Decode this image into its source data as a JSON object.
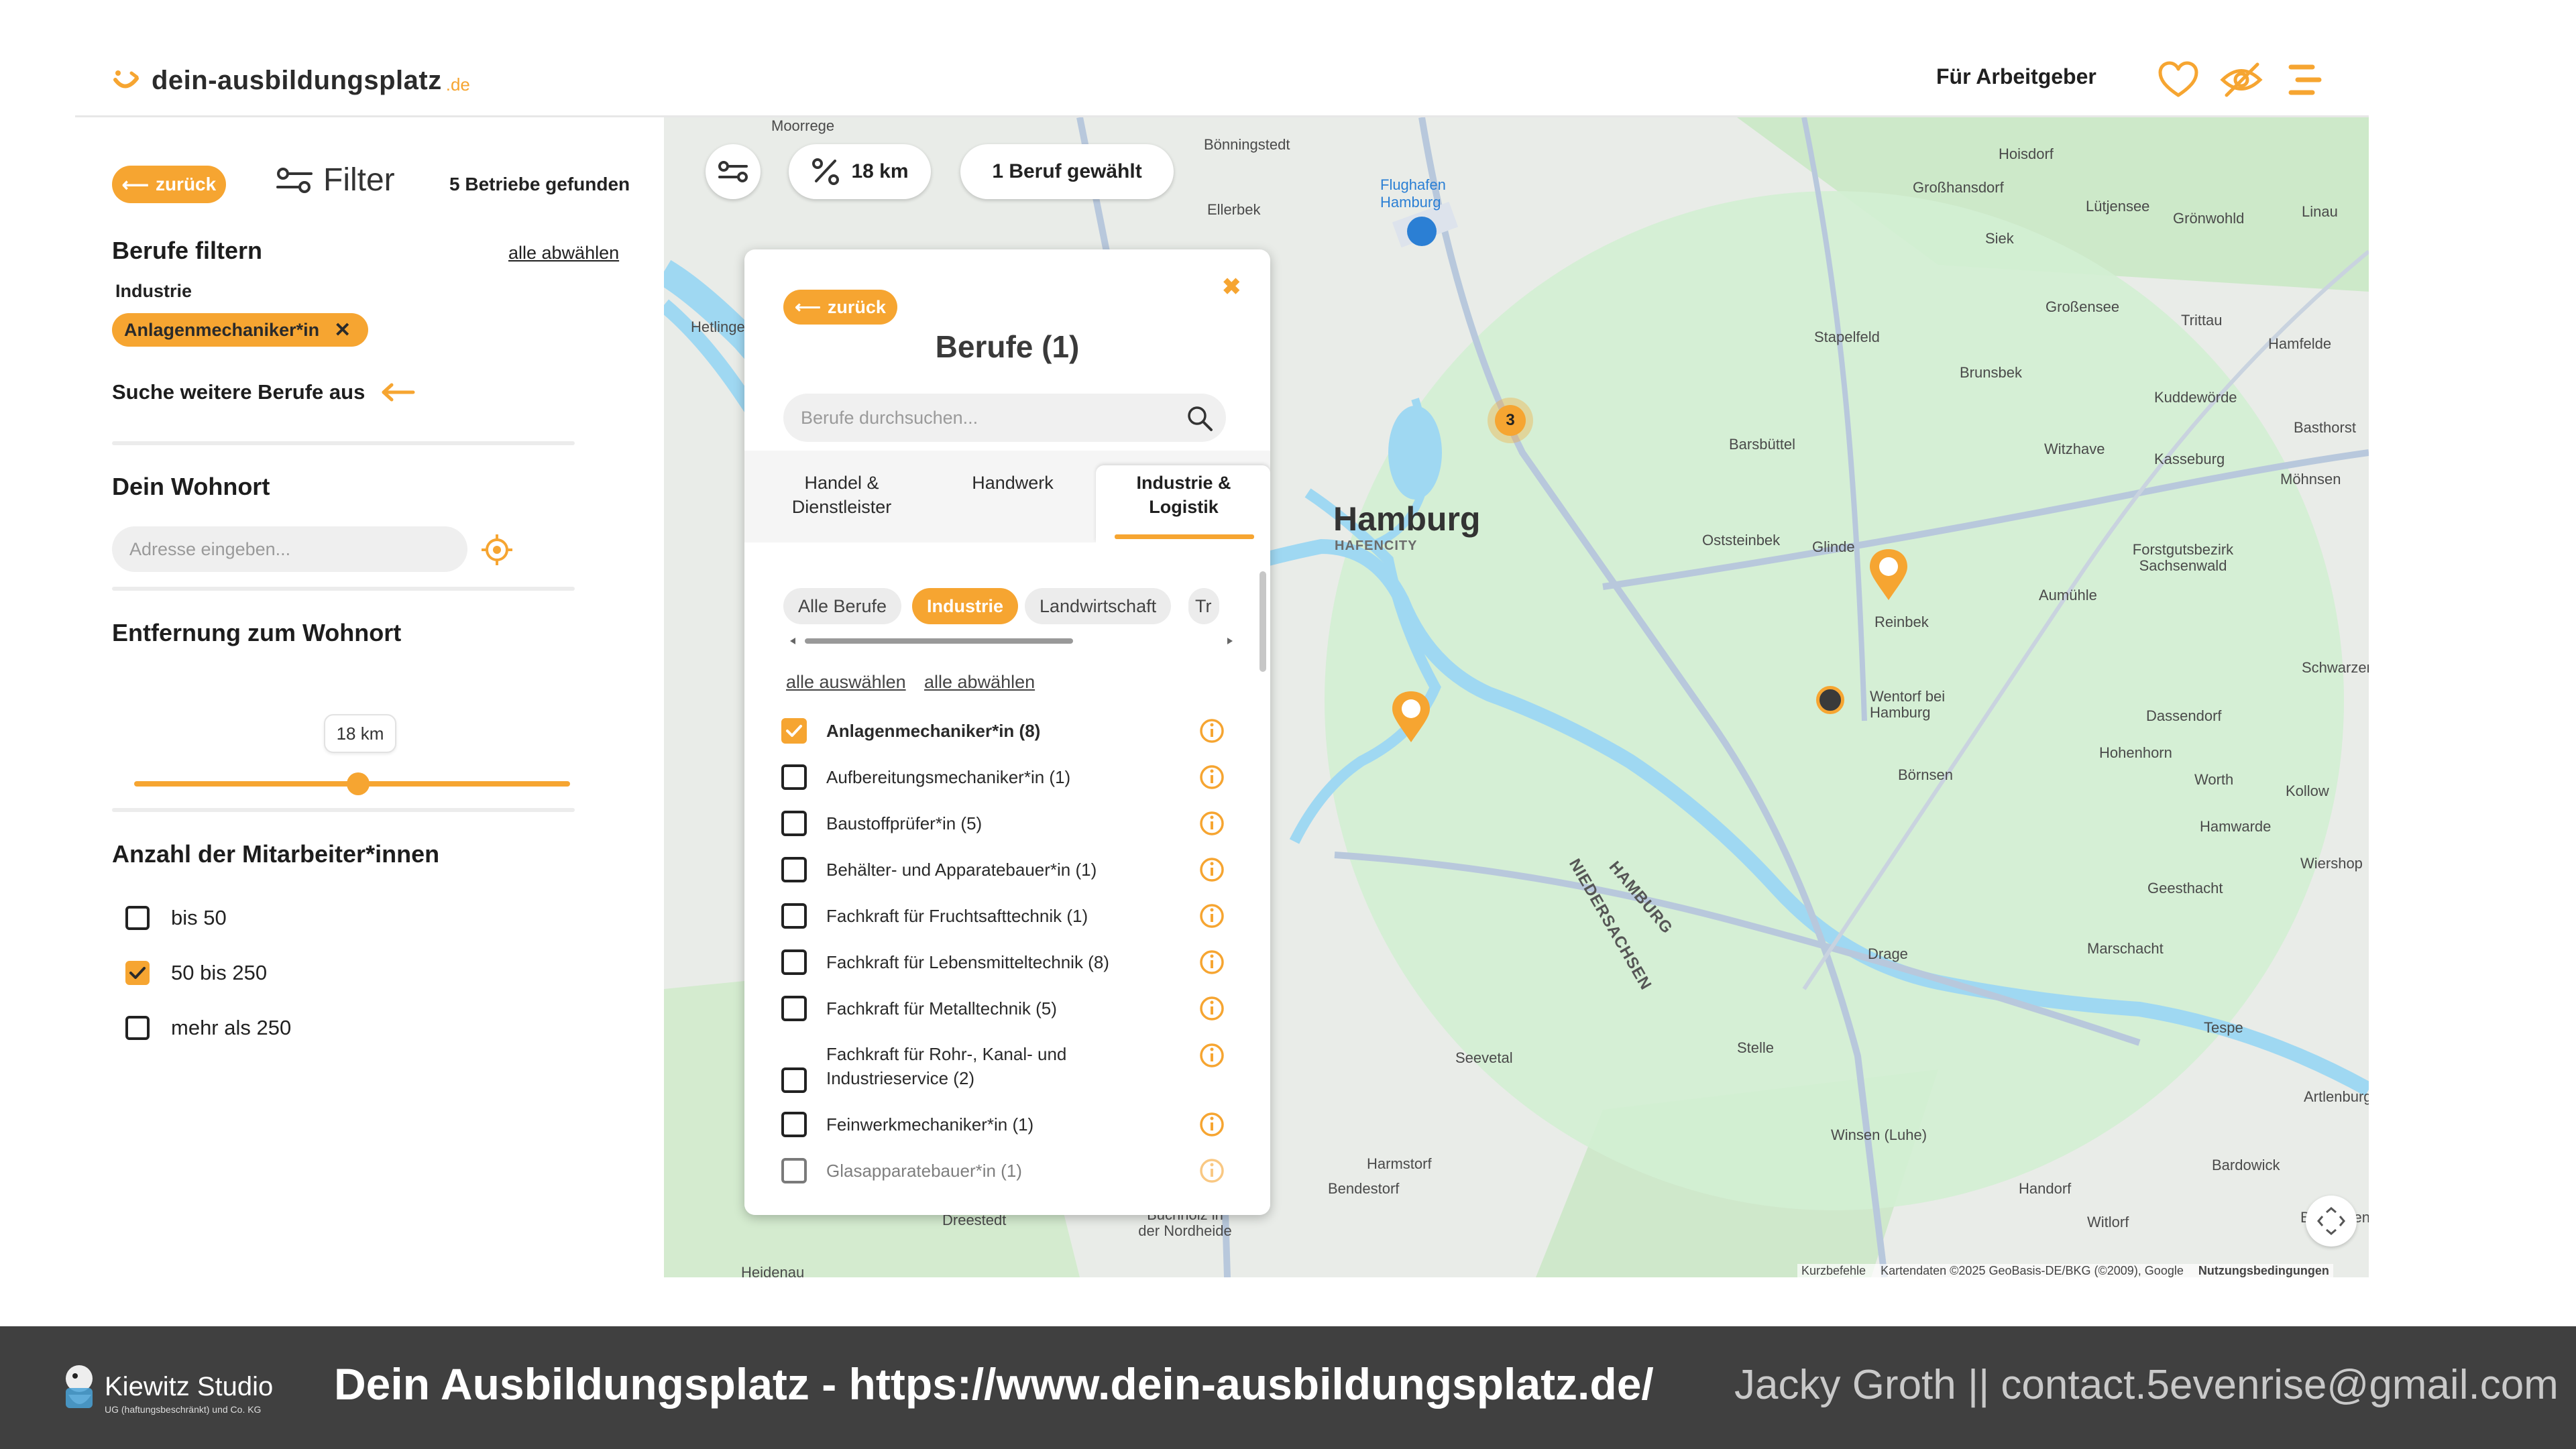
{
  "header": {
    "logo_name": "dein-ausbildungsplatz",
    "logo_tld": ".de",
    "employer_link": "Für Arbeitgeber",
    "icons": [
      "heart-icon",
      "hidden-eye-icon",
      "menu-icon"
    ]
  },
  "sidebar": {
    "back_label": "zurück",
    "filter_title": "Filter",
    "found_text": "5 Betriebe gefunden",
    "jobs_filter": {
      "heading": "Berufe filtern",
      "deselect_all": "alle abwählen",
      "category": "Industrie",
      "selected_chip": "Anlagenmechaniker*in",
      "more_jobs": "Suche weitere Berufe aus"
    },
    "residence": {
      "heading": "Dein Wohnort",
      "placeholder": "Adresse eingeben..."
    },
    "distance": {
      "heading": "Entfernung zum Wohnort",
      "value_label": "18 km",
      "value_km": 18
    },
    "employees": {
      "heading": "Anzahl der Mitarbeiter*innen",
      "options": [
        {
          "label": "bis 50",
          "checked": false
        },
        {
          "label": "50 bis 250",
          "checked": true
        },
        {
          "label": "mehr als 250",
          "checked": false
        }
      ]
    }
  },
  "map": {
    "controls": {
      "distance": "18 km",
      "jobs_selected": "1 Beruf gewählt"
    },
    "city": "Hamburg",
    "cluster_count": "3",
    "labels": {
      "hafencity": "HAFENCITY",
      "airport": "Flughafen Hamburg",
      "hamburg_state": "HAMBURG",
      "niedersachsen": "NIEDERSACHSEN",
      "towns": [
        "Moorrege",
        "Bönningstedt",
        "Hoisdorf",
        "Großhansdorf",
        "Lütjensee",
        "Grönwohld",
        "Linau",
        "Ellerbek",
        "Siek",
        "Großensee",
        "Trittau",
        "Hamfelde",
        "Stapelfeld",
        "Brunsbek",
        "Kuddewörde",
        "Barsbüttel",
        "Witzhave",
        "Basthorst",
        "Kasseburg",
        "Möhnsen",
        "Oststeinbek",
        "Glinde",
        "Forstgutsbezirk Sachsenwald",
        "Reinbek",
        "Aumühle",
        "Schwarzenbek",
        "Wentorf bei Hamburg",
        "Dassendorf",
        "Hohenhorn",
        "Börnsen",
        "Worth",
        "Kollow",
        "Hamwarde",
        "Wiershop",
        "Geesthacht",
        "Drage",
        "Marschacht",
        "Tespe",
        "Stelle",
        "Seevetal",
        "Winsen (Luhe)",
        "Harmstorf",
        "Bendestorf",
        "Handorf",
        "Bardowick",
        "Artlenburg",
        "Witlorf",
        "Brietlingen",
        "Buchholz in der Nordheide",
        "Dreestedt",
        "Hetlingen",
        "Heidenau"
      ]
    },
    "attribution": {
      "shortcuts": "Kurzbefehle",
      "data": "Kartendaten ©2025 GeoBasis-DE/BKG (©2009), Google",
      "terms": "Nutzungsbedingungen"
    }
  },
  "jobs_panel": {
    "back_label": "zurück",
    "title": "Berufe (1)",
    "search_placeholder": "Berufe durchsuchen...",
    "tabs": [
      "Handel & Dienstleister",
      "Handwerk",
      "Industrie & Logistik"
    ],
    "active_tab": "Industrie & Logistik",
    "chips": [
      {
        "label": "Alle Berufe",
        "active": false
      },
      {
        "label": "Industrie",
        "active": true
      },
      {
        "label": "Landwirtschaft",
        "active": false
      },
      {
        "label": "Tr",
        "active": false
      }
    ],
    "select_all": "alle auswählen",
    "deselect_all": "alle abwählen",
    "jobs": [
      {
        "label": "Anlagenmechaniker*in (8)",
        "checked": true
      },
      {
        "label": "Aufbereitungsmechaniker*in (1)",
        "checked": false
      },
      {
        "label": "Baustoffprüfer*in (5)",
        "checked": false
      },
      {
        "label": "Behälter- und Apparatebauer*in (1)",
        "checked": false
      },
      {
        "label": "Fachkraft für Fruchtsafttechnik (1)",
        "checked": false
      },
      {
        "label": "Fachkraft für Lebensmitteltechnik (8)",
        "checked": false
      },
      {
        "label": "Fachkraft für Metalltechnik (5)",
        "checked": false
      },
      {
        "label": "Fachkraft für Rohr-, Kanal- und Industrieservice (2)",
        "checked": false
      },
      {
        "label": "Feinwerkmechaniker*in (1)",
        "checked": false
      },
      {
        "label": "Glasapparatebauer*in (1)",
        "checked": false
      }
    ]
  },
  "footer": {
    "studio_name": "Kiewitz Studio",
    "studio_sub": "UG (haftungsbeschränkt) und Co. KG",
    "title": "Dein Ausbildungsplatz - https://www.dein-ausbildungsplatz.de/",
    "contact": "Jacky Groth || contact.5evenrise@gmail.com"
  },
  "colors": {
    "accent": "#f6a531",
    "footer_bg": "#404040",
    "map_water": "#9fd8f2",
    "map_radius": "#cfeecf"
  }
}
